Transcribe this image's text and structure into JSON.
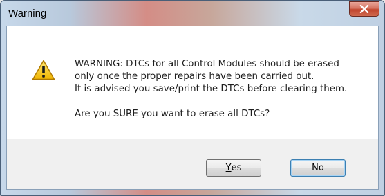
{
  "window": {
    "title": "Warning",
    "close_label": "x"
  },
  "icon": {
    "name": "warning-icon",
    "color": "#f5c400"
  },
  "message": {
    "lines": [
      "WARNING: DTCs for all Control Modules should be erased",
      "only once the proper repairs have been carried out.",
      "It is advised you save/print the DTCs before clearing them."
    ],
    "question": "Are you SURE you want to erase all DTCs?"
  },
  "buttons": {
    "yes_mnemonic": "Y",
    "yes_rest": "es",
    "no_label": "No"
  }
}
